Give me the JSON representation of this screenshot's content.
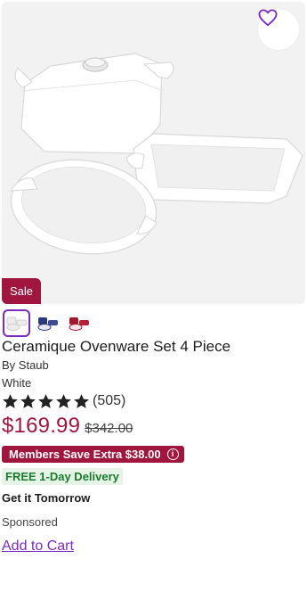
{
  "product": {
    "title": "Ceramique Ovenware Set 4 Piece",
    "brand": "By Staub",
    "color": "White",
    "sale_badge": "Sale",
    "rating": 5,
    "rating_count": "(505)",
    "price": "$169.99",
    "original_price": "$342.00",
    "members_offer": "Members Save Extra $38.00",
    "info_symbol": "i",
    "delivery_badge": "FREE 1-Day Delivery",
    "delivery_eta": "Get it Tomorrow",
    "sponsored_label": "Sponsored",
    "add_to_cart_label": "Add to Cart"
  },
  "swatches": [
    {
      "name": "white",
      "color": "#f2f2f2",
      "selected": true
    },
    {
      "name": "blue",
      "color": "#2a3a7a",
      "selected": false
    },
    {
      "name": "red",
      "color": "#a3182c",
      "selected": false
    }
  ],
  "colors": {
    "accent_purple": "#7b2cbf",
    "sale_red": "#a0163e",
    "delivery_green": "#1a7a2e",
    "delivery_bg": "#e6f4e7"
  },
  "icons": {
    "favorite": "heart-outline-icon",
    "star": "star-icon",
    "info": "info-icon"
  }
}
